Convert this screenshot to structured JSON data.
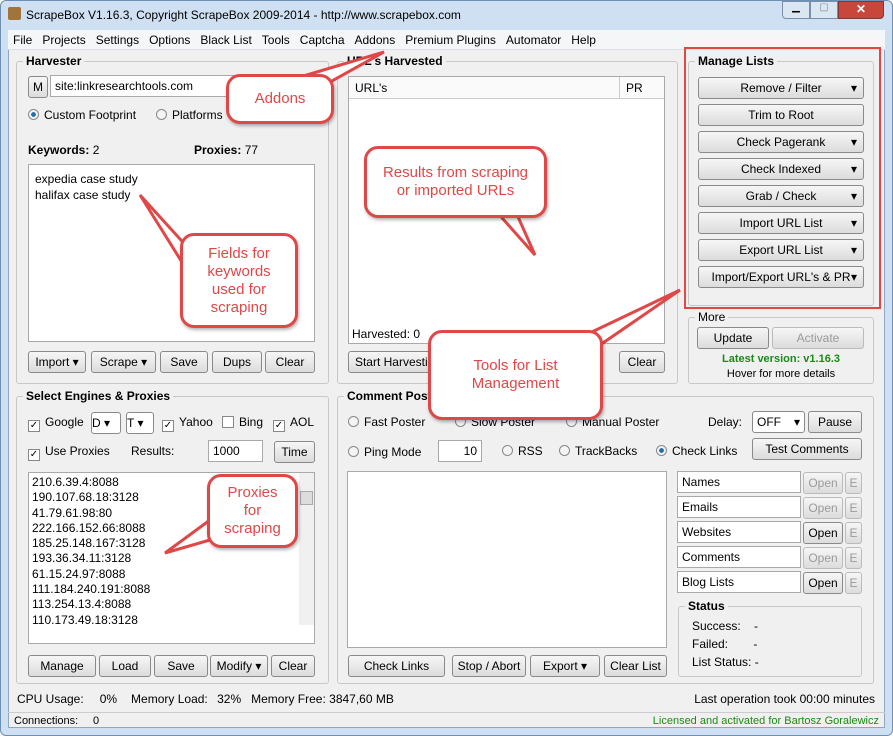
{
  "window": {
    "title": "ScrapeBox V1.16.3, Copyright ScrapeBox 2009-2014 - http://www.scrapebox.com"
  },
  "menu": [
    "File",
    "Projects",
    "Settings",
    "Options",
    "Black List",
    "Tools",
    "Captcha",
    "Addons",
    "Premium Plugins",
    "Automator",
    "Help"
  ],
  "harvester": {
    "title": "Harvester",
    "m_label": "M",
    "query": "site:linkresearchtools.com",
    "custom_footprint": "Custom Footprint",
    "platforms": "Platforms",
    "keywords_label": "Keywords:",
    "keywords_count": "2",
    "proxies_label": "Proxies:",
    "proxies_count": "77",
    "keywords": "expedia case study\nhalifax case study",
    "buttons": [
      "Import",
      "Scrape",
      "Save",
      "Dups",
      "Clear"
    ]
  },
  "urls": {
    "title": "URL's Harvested",
    "col_url": "URL's",
    "col_pr": "PR",
    "harvested_label": "Harvested:",
    "harvested_count": "0",
    "start": "Start Harvesting",
    "clear": "Clear"
  },
  "manage": {
    "title": "Manage Lists",
    "buttons": [
      "Remove / Filter",
      "Trim to Root",
      "Check Pagerank",
      "Check Indexed",
      "Grab / Check",
      "Import URL List",
      "Export URL List",
      "Import/Export URL's & PR"
    ]
  },
  "more": {
    "title": "More",
    "update": "Update",
    "activate": "Activate",
    "latest": "Latest version: v1.16.3",
    "hover": "Hover for more details"
  },
  "engines": {
    "title": "Select Engines & Proxies",
    "google": "Google",
    "d": "D",
    "t": "T",
    "yahoo": "Yahoo",
    "bing": "Bing",
    "aol": "AOL",
    "use_proxies": "Use Proxies",
    "results_label": "Results:",
    "results": "1000",
    "time": "Time",
    "proxies": [
      "210.6.39.4:8088",
      "190.107.68.18:3128",
      "41.79.61.98:80",
      "222.166.152.66:8088",
      "185.25.148.167:3128",
      "193.36.34.11:3128",
      "61.15.24.97:8088",
      "111.184.240.191:8088",
      "113.254.13.4:8088",
      "110.173.49.18:3128"
    ],
    "buttons": [
      "Manage",
      "Load",
      "Save",
      "Modify",
      "Clear"
    ]
  },
  "poster": {
    "title": "Comment Poster",
    "fast": "Fast Poster",
    "slow": "Slow Poster",
    "manual": "Manual Poster",
    "delay_label": "Delay:",
    "delay": "OFF",
    "pause": "Pause",
    "ping": "Ping Mode",
    "ping_val": "10",
    "rss": "RSS",
    "trackbacks": "TrackBacks",
    "check_links": "Check Links",
    "test": "Test Comments",
    "lists": [
      {
        "name": "Names",
        "open": "Open",
        "e": "E",
        "enabled": false
      },
      {
        "name": "Emails",
        "open": "Open",
        "e": "E",
        "enabled": false
      },
      {
        "name": "Websites",
        "open": "Open",
        "e": "E",
        "enabled": true
      },
      {
        "name": "Comments",
        "open": "Open",
        "e": "E",
        "enabled": false
      },
      {
        "name": "Blog Lists",
        "open": "Open",
        "e": "E",
        "enabled": true
      }
    ],
    "buttons": [
      "Check Links",
      "Stop / Abort",
      "Export",
      "Clear List"
    ]
  },
  "status": {
    "title": "Status",
    "success": "Success:",
    "failed": "Failed:",
    "list_status": "List Status:",
    "val": "-"
  },
  "footer": {
    "cpu_label": "CPU Usage:",
    "cpu": "0%",
    "mem_label": "Memory Load:",
    "mem": "32%",
    "free_label": "Memory Free:",
    "free": "3847,60 MB",
    "last_op": "Last operation took 00:00 minutes",
    "connections_label": "Connections:",
    "connections": "0",
    "licensed": "Licensed and activated for Bartosz Goralewicz"
  },
  "callouts": {
    "addons": "Addons",
    "results": "Results from scraping or imported URLs",
    "keywords": "Fields for keywords used for scraping",
    "tools": "Tools for List Management",
    "proxies": "Proxies for scraping"
  },
  "colors": {
    "callout": "#e04848",
    "latest": "#1a8a1a"
  }
}
